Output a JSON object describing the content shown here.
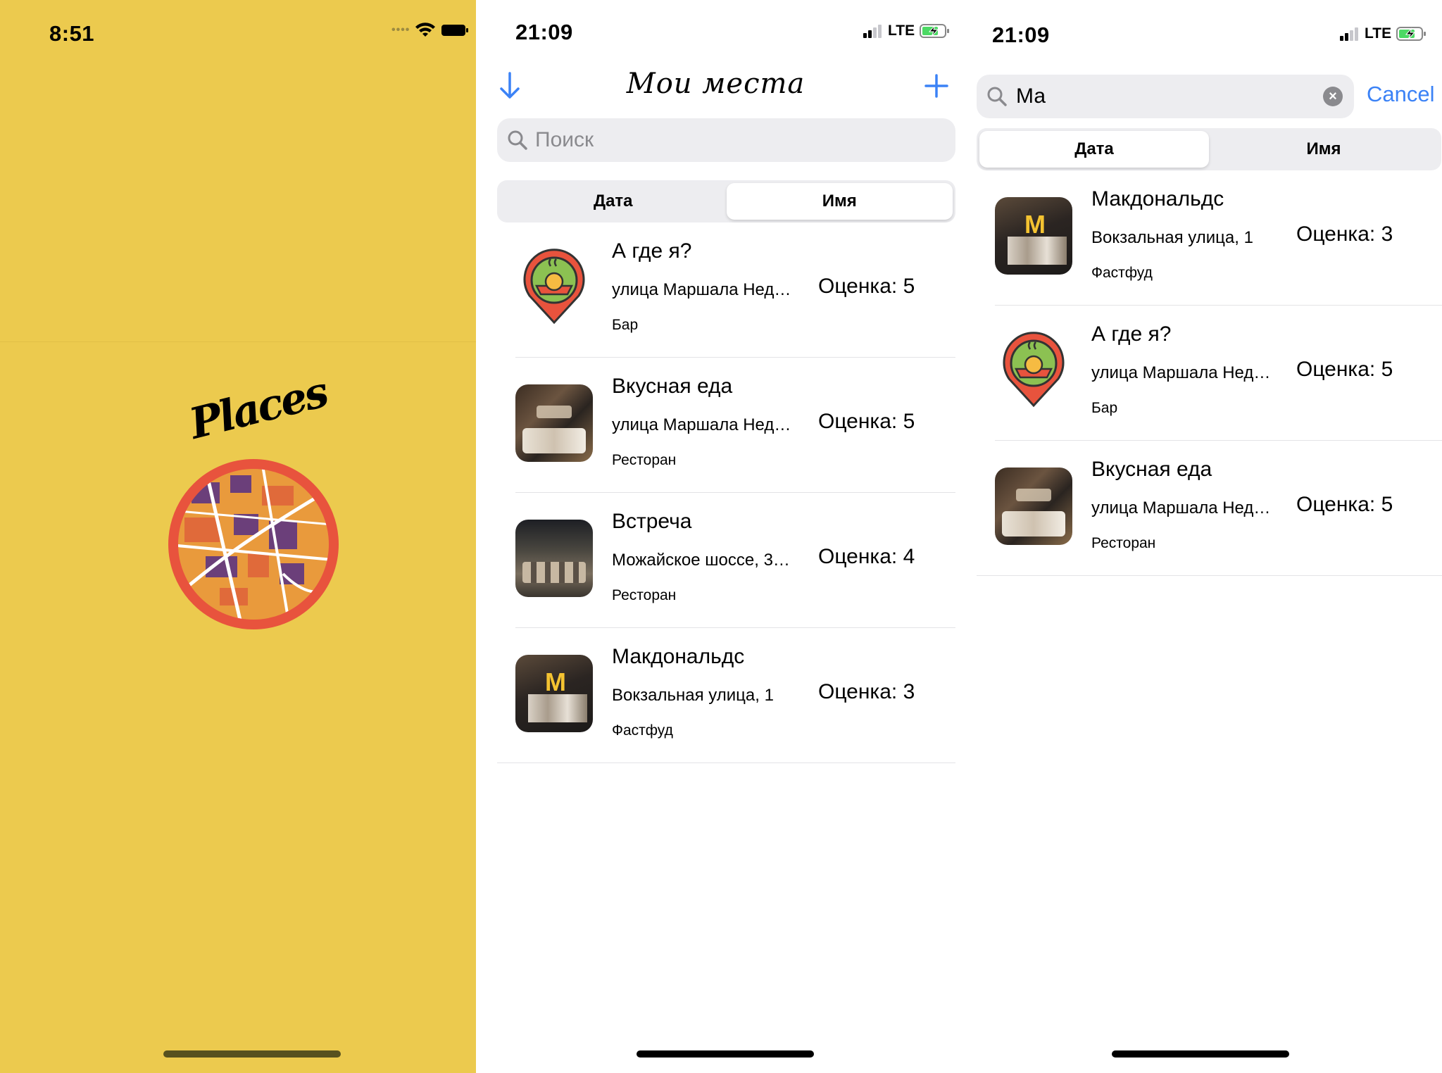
{
  "splash": {
    "status_time": "8:51",
    "logo_text": "Places",
    "background": "#ECCA4E"
  },
  "list_screen": {
    "status_time": "21:09",
    "network": "LTE",
    "nav_title": "Мои места",
    "sort_icon": "arrow-down-icon",
    "add_icon": "plus-icon",
    "search_placeholder": "Поиск",
    "segments": [
      "Дата",
      "Имя"
    ],
    "selected_segment": "Имя",
    "places": [
      {
        "name": "А где я?",
        "address": "улица Маршала Нед…",
        "type": "Бар",
        "rating": "Оценка: 5",
        "image": "food-pin-icon"
      },
      {
        "name": "Вкусная еда",
        "address": "улица Маршала Нед…",
        "type": "Ресторан",
        "rating": "Оценка: 5",
        "image": "restaurant-photo"
      },
      {
        "name": "Встреча",
        "address": "Можайское шоссе, 3…",
        "type": "Ресторан",
        "rating": "Оценка: 4",
        "image": "hall-photo"
      },
      {
        "name": "Макдональдс",
        "address": "Вокзальная улица, 1",
        "type": "Фастфуд",
        "rating": "Оценка: 3",
        "image": "mcdonalds-photo"
      }
    ]
  },
  "search_screen": {
    "status_time": "21:09",
    "network": "LTE",
    "search_value": "Ма",
    "cancel_label": "Cancel",
    "segments": [
      "Дата",
      "Имя"
    ],
    "selected_segment": "Дата",
    "places": [
      {
        "name": "Макдональдс",
        "address": "Вокзальная улица, 1",
        "type": "Фастфуд",
        "rating": "Оценка: 3",
        "image": "mcdonalds-photo"
      },
      {
        "name": "А где я?",
        "address": "улица Маршала Нед…",
        "type": "Бар",
        "rating": "Оценка: 5",
        "image": "food-pin-icon"
      },
      {
        "name": "Вкусная еда",
        "address": "улица Маршала Нед…",
        "type": "Ресторан",
        "rating": "Оценка: 5",
        "image": "restaurant-photo"
      }
    ]
  },
  "colors": {
    "accent": "#3B82F6",
    "splash_bg": "#ECCA4E",
    "battery_charge": "#4CD964"
  }
}
